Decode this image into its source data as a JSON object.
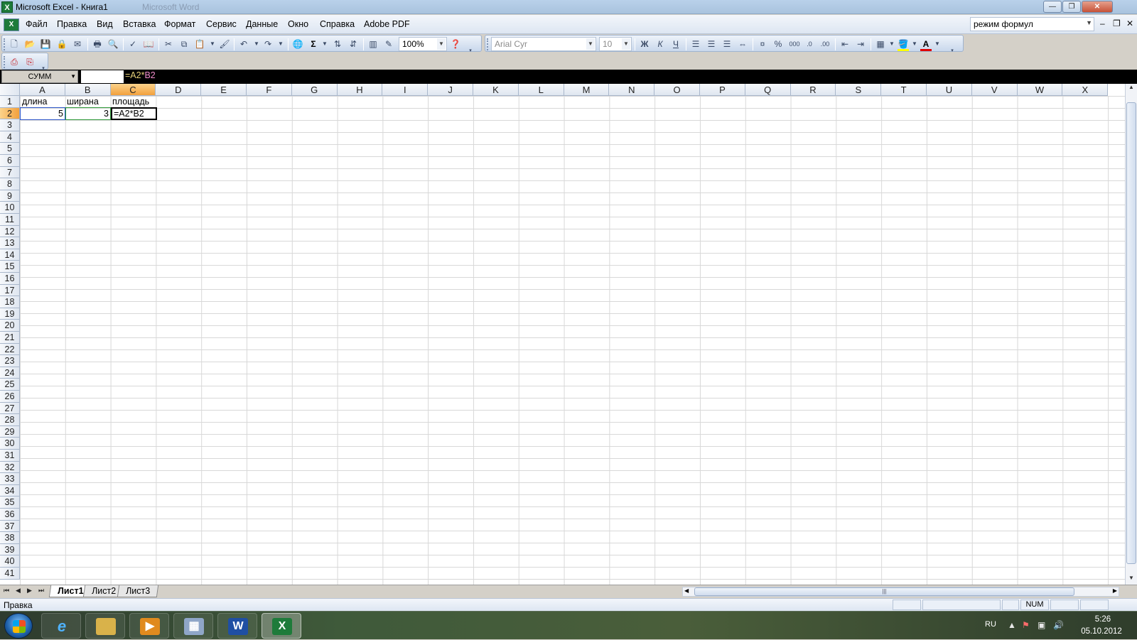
{
  "window": {
    "title": "Microsoft Excel - Книга1",
    "ghost_title": "Microsoft Word",
    "buttons": {
      "minimize": "—",
      "restore": "❐",
      "close": "✕"
    }
  },
  "menu": {
    "items": [
      {
        "label": "Файл"
      },
      {
        "label": "Правка"
      },
      {
        "label": "Вид"
      },
      {
        "label": "Вставка"
      },
      {
        "label": "Формат"
      },
      {
        "label": "Сервис"
      },
      {
        "label": "Данные"
      },
      {
        "label": "Окно"
      },
      {
        "label": "Справка"
      },
      {
        "label": "Adobe PDF"
      }
    ],
    "help_box": "режим формул",
    "mdi_buttons": {
      "minimize": "–",
      "restore": "❐",
      "close": "✕"
    }
  },
  "toolbar": {
    "zoom": "100%",
    "font_name": "Arial Cyr",
    "font_size": "10",
    "bold": "Ж",
    "italic": "К",
    "underline": "Ч",
    "sum_symbol": "Σ",
    "percent": "%",
    "thousands": "000",
    "font_color": "#e00000",
    "fill_color": "#ffff00"
  },
  "formula_bar": {
    "name_box": "СУММ",
    "formula_part1": "=A2*",
    "formula_part2": "B2"
  },
  "sheet": {
    "columns": [
      "A",
      "B",
      "C",
      "D",
      "E",
      "F",
      "G",
      "H",
      "I",
      "J",
      "K",
      "L",
      "M",
      "N",
      "O",
      "P",
      "Q",
      "R",
      "S",
      "T",
      "U",
      "V",
      "W",
      "X"
    ],
    "selected_column": "C",
    "selected_row": "2",
    "cells": {
      "A1": "длина",
      "B1": "ширана",
      "C1": "площадь",
      "A2": "5",
      "B2": "3",
      "C2": "=A2*B2"
    },
    "tabs": [
      {
        "label": "Лист1"
      },
      {
        "label": "Лист2"
      },
      {
        "label": "Лист3"
      }
    ]
  },
  "status_bar": {
    "mode": "Правка",
    "num_lock": "NUM"
  },
  "taskbar": {
    "language": "RU",
    "time": "5:26",
    "date": "05.10.2012"
  }
}
